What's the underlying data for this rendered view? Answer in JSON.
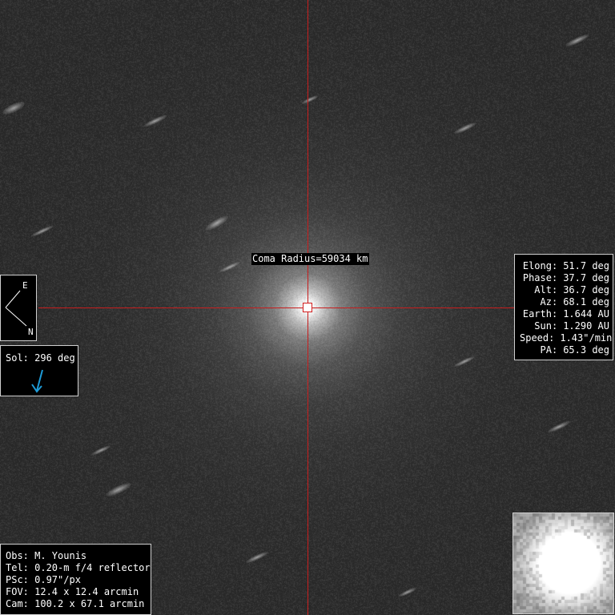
{
  "coma_label": "Coma Radius=59034 km",
  "info": [
    {
      "k": "Elong:",
      "v": "51.7 deg"
    },
    {
      "k": "Phase:",
      "v": "37.7 deg"
    },
    {
      "k": "Alt:",
      "v": "36.7 deg"
    },
    {
      "k": "Az:",
      "v": "68.1 deg"
    },
    {
      "k": "Earth:",
      "v": "1.644 AU"
    },
    {
      "k": "Sun:",
      "v": "1.290 AU"
    },
    {
      "k": "Speed:",
      "v": "1.43\"/min"
    },
    {
      "k": "PA:",
      "v": "65.3 deg"
    }
  ],
  "compass": {
    "east": "E",
    "north": "N"
  },
  "sol": {
    "label": "Sol: 296 deg",
    "arrow_color": "#1e9bd7"
  },
  "observer": [
    "Obs: M. Younis",
    "Tel: 0.20-m f/4 reflector",
    "PSc: 0.97\"/px",
    "FOV: 12.4 x 12.4 arcmin",
    "Cam: 100.2 x 67.1 arcmin"
  ],
  "colors": {
    "crosshair": "#c81e1e",
    "panel_bg": "#000000",
    "panel_border": "#cfcfcf"
  }
}
